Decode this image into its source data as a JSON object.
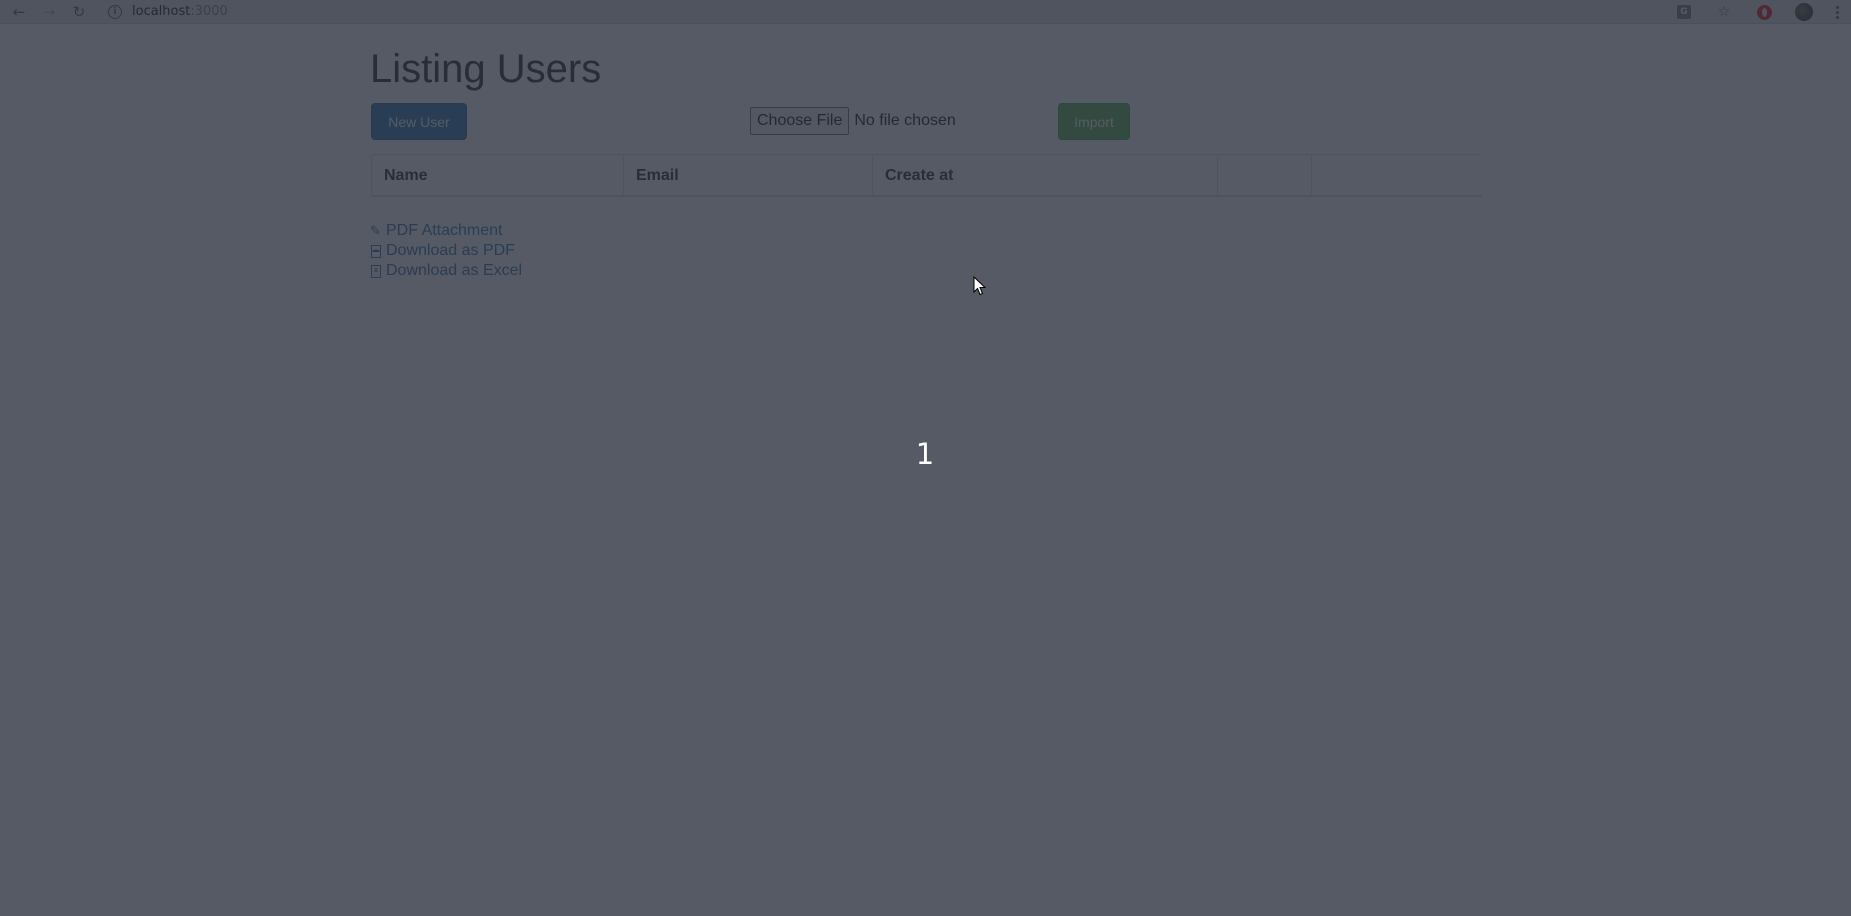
{
  "browser": {
    "url_host": "localhost",
    "url_port": ":3000",
    "back_icon": "arrow-left-icon",
    "forward_icon": "arrow-right-icon",
    "reload_icon": "reload-icon",
    "info_icon": "info-icon",
    "translate_icon": "translate-icon",
    "star_icon": "star-icon",
    "extension_icon": "opera-icon",
    "avatar_icon": "avatar-icon",
    "menu_icon": "kebab-menu-icon"
  },
  "page": {
    "title": "Listing Users",
    "new_user_label": "New User",
    "choose_file_label": "Choose File",
    "file_status": "No file chosen",
    "import_label": "Import"
  },
  "table": {
    "headers": [
      "Name",
      "Email",
      "Create at",
      ""
    ]
  },
  "links": [
    {
      "label": "PDF Attachment",
      "icon": "paperclip-icon"
    },
    {
      "label": "Download as PDF",
      "icon": "pdf-file-icon"
    },
    {
      "label": "Download as Excel",
      "icon": "excel-file-icon"
    }
  ],
  "overlay": {
    "step_number": "1"
  },
  "colors": {
    "primary": "#337ab7",
    "success": "#5cb85c",
    "overlay": "#262c38"
  }
}
